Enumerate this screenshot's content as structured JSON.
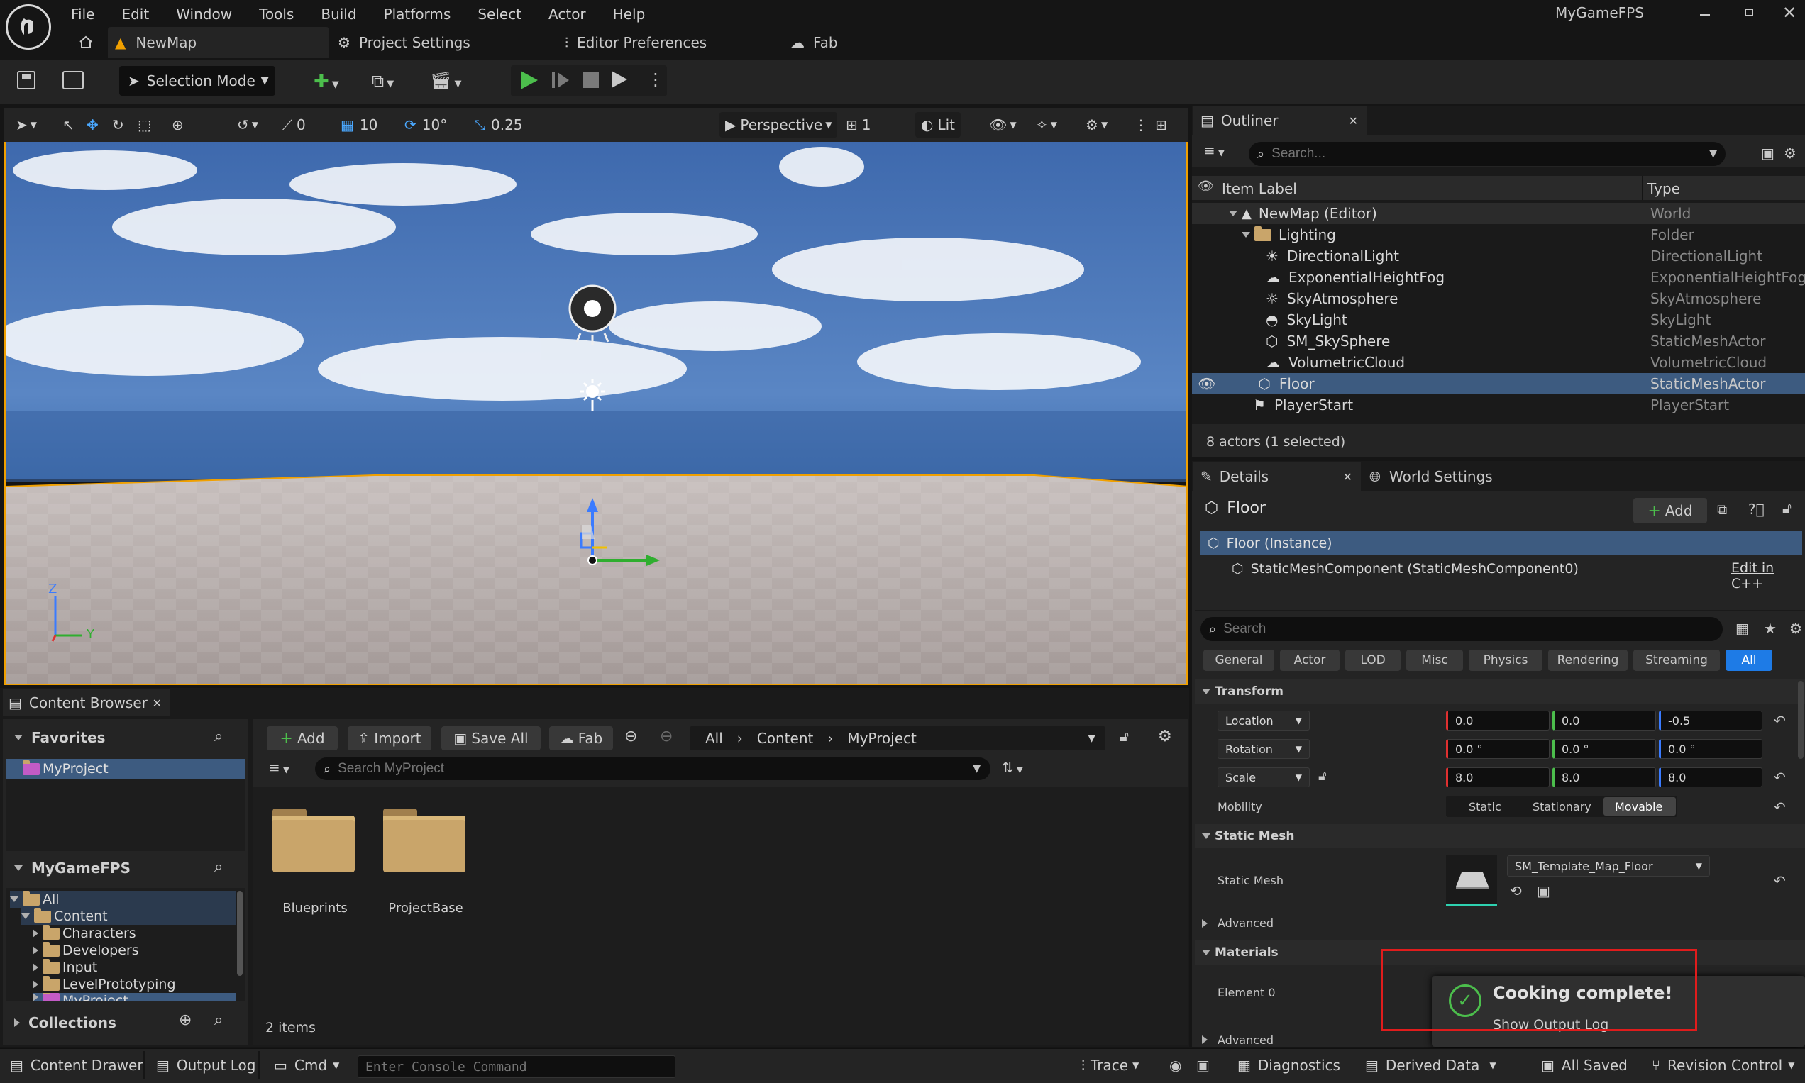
{
  "app": {
    "title": "MyGameFPS",
    "logo": "unreal-logo"
  },
  "menu": [
    "File",
    "Edit",
    "Window",
    "Tools",
    "Build",
    "Platforms",
    "Select",
    "Actor",
    "Help"
  ],
  "tabs": {
    "map": "NewMap",
    "project_settings": "Project Settings",
    "editor_prefs": "Editor Preferences",
    "fab": "Fab"
  },
  "toolbar": {
    "mode": "Selection Mode"
  },
  "viewport": {
    "snap_rot": "0",
    "grid": "10",
    "rot": "10°",
    "scale": "0.25",
    "perspective": "Perspective",
    "cams": "1",
    "lit": "Lit",
    "axis_z": "Z",
    "axis_y": "Y",
    "colors": {
      "sky": "#4a74b5",
      "floor": "#b9b1af",
      "accent": "#f0a000"
    }
  },
  "outliner": {
    "title": "Outliner",
    "search_placeholder": "Search...",
    "col_label": "Item Label",
    "col_type": "Type",
    "rows": [
      {
        "label": "NewMap (Editor)",
        "type": "World",
        "icon": "map-icon"
      },
      {
        "label": "Lighting",
        "type": "Folder",
        "icon": "folder-icon"
      },
      {
        "label": "DirectionalLight",
        "type": "DirectionalLight",
        "icon": "sun-icon"
      },
      {
        "label": "ExponentialHeightFog",
        "type": "ExponentialHeightFog",
        "icon": "fog-icon"
      },
      {
        "label": "SkyAtmosphere",
        "type": "SkyAtmosphere",
        "icon": "atmosphere-icon"
      },
      {
        "label": "SkyLight",
        "type": "SkyLight",
        "icon": "skylight-icon"
      },
      {
        "label": "SM_SkySphere",
        "type": "StaticMeshActor",
        "icon": "mesh-icon"
      },
      {
        "label": "VolumetricCloud",
        "type": "VolumetricCloud",
        "icon": "cloud-icon"
      },
      {
        "label": "Floor",
        "type": "StaticMeshActor",
        "icon": "mesh-icon"
      },
      {
        "label": "PlayerStart",
        "type": "PlayerStart",
        "icon": "playerstart-icon"
      }
    ],
    "status": "8 actors (1 selected)"
  },
  "details": {
    "tab": "Details",
    "world_settings": "World Settings",
    "actor": "Floor",
    "add": "Add",
    "instance": "Floor (Instance)",
    "component": "StaticMeshComponent (StaticMeshComponent0)",
    "edit_cpp": "Edit in C++",
    "search_placeholder": "Search",
    "categories": [
      "General",
      "Actor",
      "LOD",
      "Misc",
      "Physics",
      "Rendering",
      "Streaming",
      "All"
    ],
    "transform": "Transform",
    "location": {
      "label": "Location",
      "x": "0.0",
      "y": "0.0",
      "z": "-0.5"
    },
    "rotation": {
      "label": "Rotation",
      "x": "0.0 °",
      "y": "0.0 °",
      "z": "0.0 °"
    },
    "scale": {
      "label": "Scale",
      "x": "8.0",
      "y": "8.0",
      "z": "8.0"
    },
    "mobility": {
      "label": "Mobility",
      "static": "Static",
      "stationary": "Stationary",
      "movable": "Movable"
    },
    "static_mesh_section": "Static Mesh",
    "static_mesh_label": "Static Mesh",
    "static_mesh_value": "SM_Template_Map_Floor",
    "advanced": "Advanced",
    "materials": "Materials",
    "element0": "Element 0",
    "advanced2": "Advanced"
  },
  "toast": {
    "title": "Cooking complete!",
    "link": "Show Output Log"
  },
  "content_browser": {
    "tab": "Content Browser",
    "add": "Add",
    "import": "Import",
    "save_all": "Save All",
    "fab": "Fab",
    "breadcrumb": [
      "All",
      "Content",
      "MyProject"
    ],
    "search_placeholder": "Search MyProject",
    "favorites": "Favorites",
    "fav_item": "MyProject",
    "project": "MyGameFPS",
    "tree": [
      "All",
      "Content",
      "Characters",
      "Developers",
      "Input",
      "LevelPrototyping",
      "MyProject"
    ],
    "collections": "Collections",
    "items": [
      {
        "name": "Blueprints"
      },
      {
        "name": "ProjectBase"
      }
    ],
    "count": "2 items"
  },
  "statusbar": {
    "content_drawer": "Content Drawer",
    "output_log": "Output Log",
    "cmd": "Cmd",
    "console_placeholder": "Enter Console Command",
    "trace": "Trace",
    "diagnostics": "Diagnostics",
    "derived_data": "Derived Data",
    "all_saved": "All Saved",
    "revision_control": "Revision Control"
  }
}
